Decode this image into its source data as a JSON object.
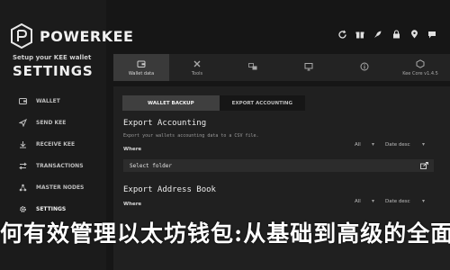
{
  "app": {
    "brand": "POWERKEE",
    "tagline": "Setup your KEE wallet",
    "section_title": "SETTINGS"
  },
  "sidebar": {
    "items": [
      {
        "label": "WALLET",
        "icon": "wallet-icon",
        "active": false
      },
      {
        "label": "SEND KEE",
        "icon": "send-icon",
        "active": false
      },
      {
        "label": "RECEIVE KEE",
        "icon": "receive-icon",
        "active": false
      },
      {
        "label": "TRANSACTIONS",
        "icon": "transactions-icon",
        "active": false
      },
      {
        "label": "MASTER NODES",
        "icon": "nodes-icon",
        "active": false
      },
      {
        "label": "SETTINGS",
        "icon": "gear-icon",
        "active": true
      }
    ]
  },
  "utility_icons": [
    "refresh-icon",
    "gift-icon",
    "rocket-icon",
    "lock-icon",
    "pin-icon",
    "chat-icon"
  ],
  "settings_tabs": [
    {
      "label": "Wallet data",
      "icon": "wallet-data-icon",
      "active": true
    },
    {
      "label": "Tools",
      "icon": "tools-icon",
      "active": false
    },
    {
      "label": "",
      "icon": "language-icon",
      "active": false
    },
    {
      "label": "",
      "icon": "display-icon",
      "active": false
    },
    {
      "label": "",
      "icon": "info-icon",
      "active": false
    },
    {
      "label": "Kee Core v1.4.5",
      "icon": "core-icon",
      "active": false
    }
  ],
  "subtabs": {
    "wallet_backup": "WALLET BACKUP",
    "export_accounting": "EXPORT ACCOUNTING"
  },
  "export_accounting": {
    "title": "Export Accounting",
    "description": "Export your wallets accounting data to a CSV file.",
    "where_label": "Where",
    "filter_value": "All",
    "sort_value": "Date desc",
    "folder_value": "Select folder"
  },
  "export_address_book": {
    "title": "Export Address Book",
    "where_label": "Where",
    "filter_value": "All",
    "sort_value": "Date desc"
  },
  "banner_text": "何有效管理以太坊钱包:从基础到高级的全面指"
}
